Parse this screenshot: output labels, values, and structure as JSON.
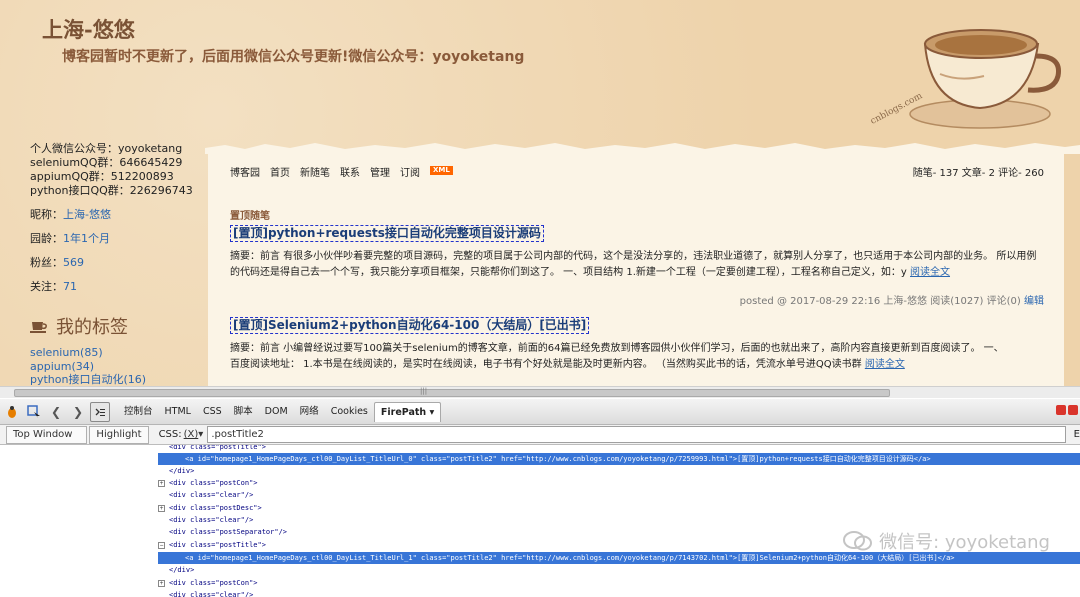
{
  "blog": {
    "title": "上海-悠悠",
    "subtitle": "博客园暂时不更新了，后面用微信公众号更新!微信公众号：yoyoketang",
    "watermark_text": "cnblogs.com"
  },
  "sidebar": {
    "info_lines": [
      "个人微信公众号：yoyoketang",
      "seleniumQQ群：646645429",
      "appiumQQ群：512200893",
      "python接口QQ群：226296743"
    ],
    "nickname_label": "昵称：",
    "nickname_value": "上海-悠悠",
    "age_label": "园龄：",
    "age_value": "1年1个月",
    "fans_label": "粉丝：",
    "fans_value": "569",
    "follow_label": "关注：",
    "follow_value": "71",
    "tags_title": "我的标签",
    "tags": [
      "selenium(85)",
      "appium(34)",
      "python接口自动化(16)"
    ]
  },
  "nav": {
    "items": [
      "博客园",
      "首页",
      "新随笔",
      "联系",
      "管理",
      "订阅"
    ],
    "xml_badge": "XML",
    "stats": "随笔- 137  文章- 2  评论- 260"
  },
  "posts": {
    "section_label": "置顶随笔",
    "items": [
      {
        "title": "[置顶]python+requests接口自动化完整项目设计源码",
        "desc_line1": "摘要：前言 有很多小伙伴吵着要完整的项目源码，完整的项目属于公司内部的代码，这个是没法分享的，违法职业道德了，就算别人分享了，也只适用于本公司内部的业务。 所以用例",
        "desc_line2": "的代码还是得自己去一个个写，我只能分享项目框架，只能帮你们到这了。 一、项目结构 1.新建一个工程（一定要创建工程），工程名称自己定义，如：y",
        "read_more": "阅读全文",
        "footer": "posted @ 2017-08-29 22:16 上海-悠悠 阅读(1027) 评论(0)",
        "edit": "编辑"
      },
      {
        "title": "[置顶]Selenium2+python自动化64-100（大结局）[已出书]",
        "desc_line1": "摘要：前言 小编曾经说过要写100篇关于selenium的博客文章，前面的64篇已经免费放到博客园供小伙伴们学习，后面的也就出来了，高阶内容直接更新到百度阅读了。 一、",
        "desc_line2": "百度阅读地址： 1.本书是在线阅读的，是实时在线阅读，电子书有个好处就是能及时更新内容。 （当然购买此书的话，凭流水单号进QQ读书群",
        "read_more": "阅读全文"
      }
    ]
  },
  "firebug": {
    "tabs": [
      "控制台",
      "HTML",
      "CSS",
      "脚本",
      "DOM",
      "网络",
      "Cookies",
      "FirePath"
    ],
    "active_tab": "FirePath",
    "firepath": {
      "window_btn": "Top Window",
      "highlight_btn": "Highlight",
      "css_label": "CSS:",
      "css_sel": "(X)",
      "query": ".postTitle2",
      "end_letter": "E"
    },
    "tree": [
      {
        "indent": 0,
        "text": "<div class=\"postTitle\">",
        "expander": "",
        "selected": false
      },
      {
        "indent": 1,
        "text": "<a id=\"homepage1_HomePageDays_ctl00_DayList_TitleUrl_0\" class=\"postTitle2\" href=\"http://www.cnblogs.com/yoyoketang/p/7259993.html\">[置顶]python+requests接口自动化完整项目设计源码</a>",
        "expander": "",
        "selected": true
      },
      {
        "indent": 0,
        "text": "</div>",
        "expander": "",
        "selected": false
      },
      {
        "indent": 0,
        "text": "<div class=\"postCon\">",
        "expander": "+",
        "selected": false
      },
      {
        "indent": 0,
        "text": "<div class=\"clear\"/>",
        "expander": "",
        "selected": false
      },
      {
        "indent": 0,
        "text": "<div class=\"postDesc\">",
        "expander": "+",
        "selected": false
      },
      {
        "indent": 0,
        "text": "<div class=\"clear\"/>",
        "expander": "",
        "selected": false
      },
      {
        "indent": 0,
        "text": "<div class=\"postSeparator\"/>",
        "expander": "",
        "selected": false
      },
      {
        "indent": 0,
        "text": "<div class=\"postTitle\">",
        "expander": "−",
        "selected": false
      },
      {
        "indent": 1,
        "text": "<a id=\"homepage1_HomePageDays_ctl00_DayList_TitleUrl_1\" class=\"postTitle2\" href=\"http://www.cnblogs.com/yoyoketang/p/7143702.html\">[置顶]Selenium2+python自动化64-100（大结局）[已出书]</a>",
        "expander": "",
        "selected": true
      },
      {
        "indent": 0,
        "text": "</div>",
        "expander": "",
        "selected": false
      },
      {
        "indent": 0,
        "text": "<div class=\"postCon\">",
        "expander": "+",
        "selected": false
      },
      {
        "indent": 0,
        "text": "<div class=\"clear\"/>",
        "expander": "",
        "selected": false
      }
    ],
    "wechat_watermark": "微信号: yoyoketang"
  }
}
